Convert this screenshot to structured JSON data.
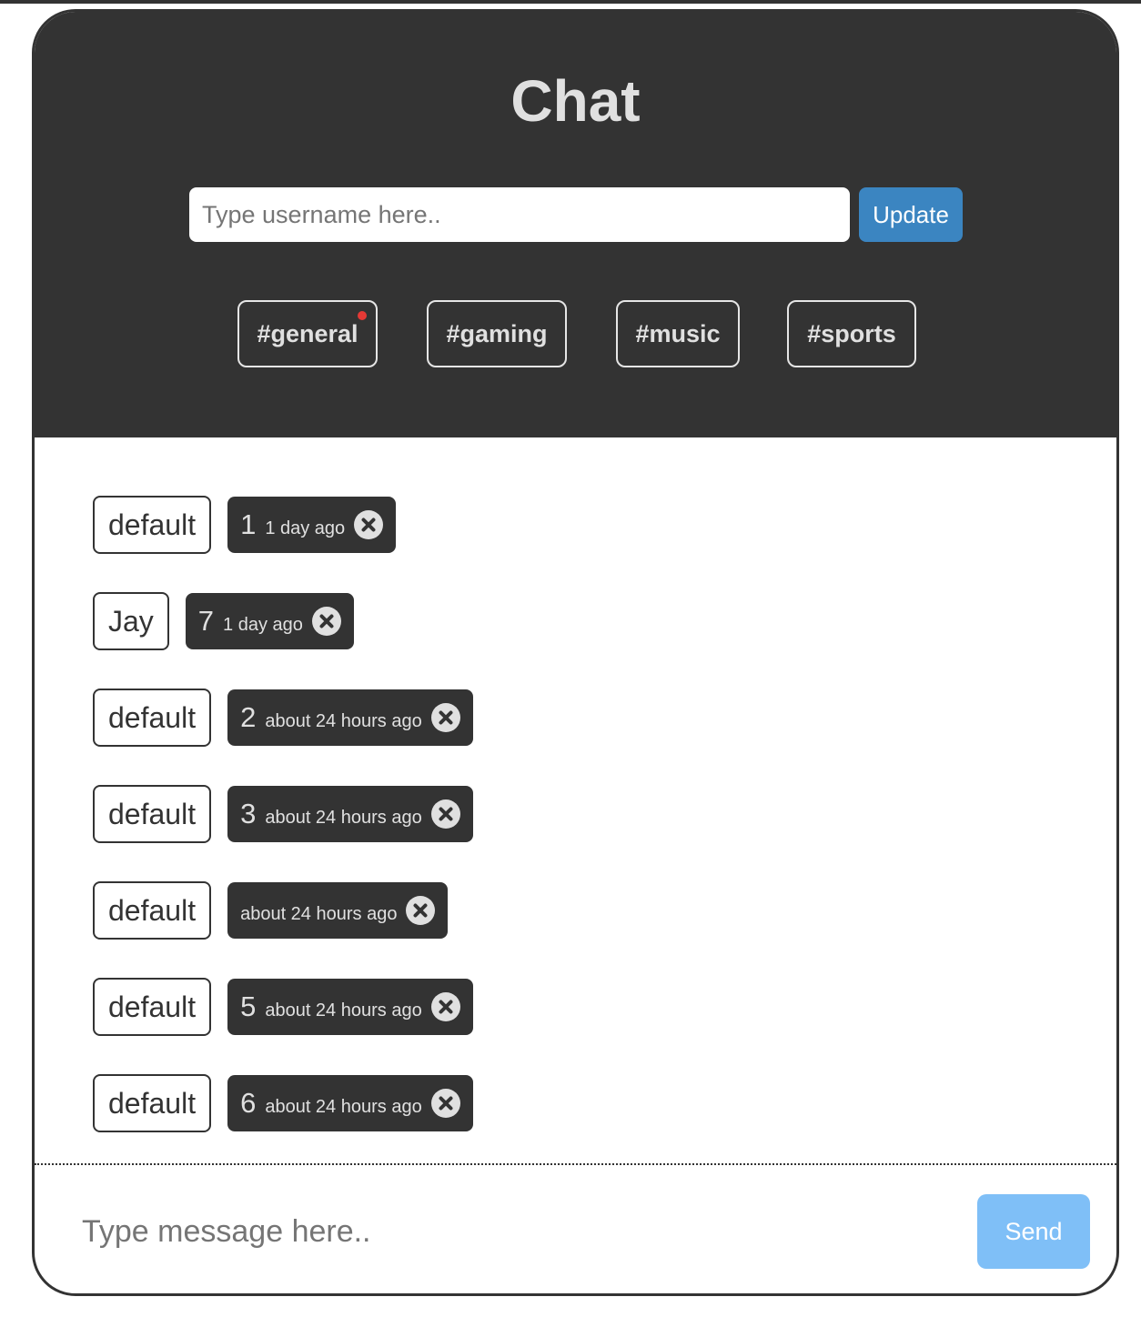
{
  "header": {
    "title": "Chat",
    "username_placeholder": "Type username here..",
    "update_label": "Update"
  },
  "channels": [
    {
      "label": "#general",
      "unread": true
    },
    {
      "label": "#gaming",
      "unread": false
    },
    {
      "label": "#music",
      "unread": false
    },
    {
      "label": "#sports",
      "unread": false
    }
  ],
  "messages": [
    {
      "user": "default",
      "text": "1",
      "time": "1 day ago"
    },
    {
      "user": "Jay",
      "text": "7",
      "time": "1 day ago"
    },
    {
      "user": "default",
      "text": "2",
      "time": "about 24 hours ago"
    },
    {
      "user": "default",
      "text": "3",
      "time": "about 24 hours ago"
    },
    {
      "user": "default",
      "text": "",
      "time": "about 24 hours ago"
    },
    {
      "user": "default",
      "text": "5",
      "time": "about 24 hours ago"
    },
    {
      "user": "default",
      "text": "6",
      "time": "about 24 hours ago"
    }
  ],
  "composer": {
    "message_placeholder": "Type message here..",
    "send_label": "Send"
  },
  "colors": {
    "dark": "#333333",
    "update_button": "#3b85c1",
    "send_button": "#7fbff7",
    "unread_dot": "#e53935"
  }
}
